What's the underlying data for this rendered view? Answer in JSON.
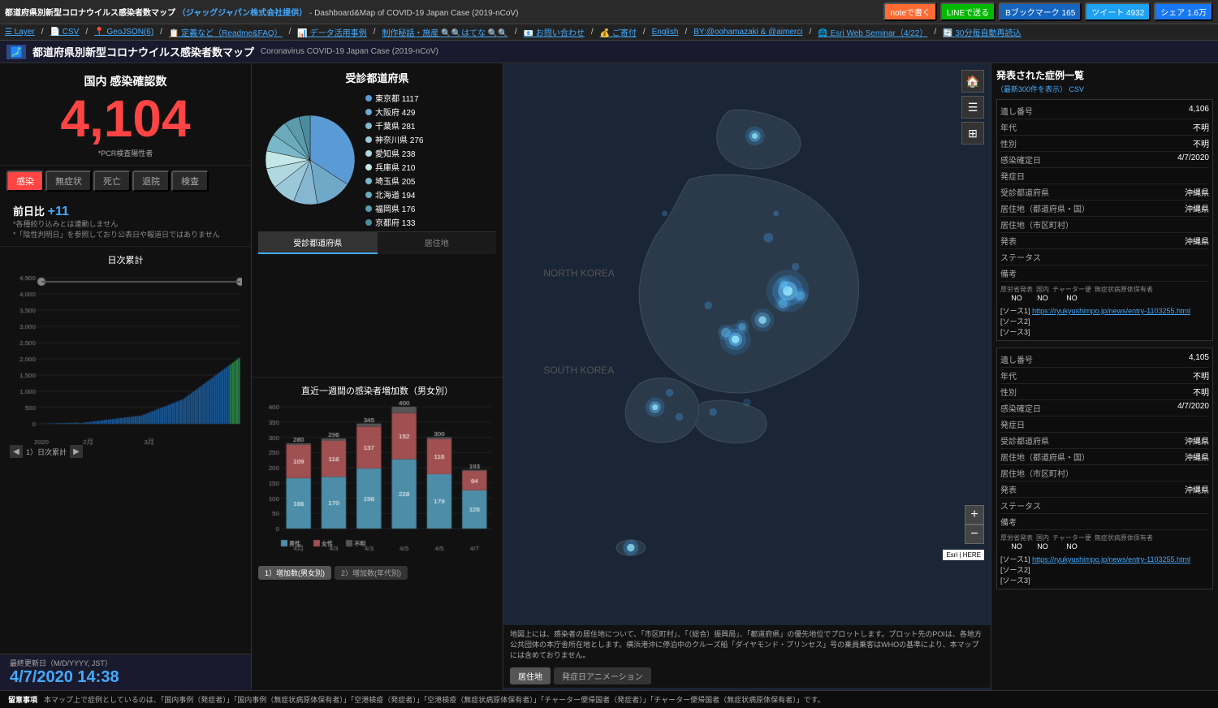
{
  "topbar": {
    "title": "都道府県別新型コロナウイルス感染者数マップ",
    "title_provider": "（ジャッグジャパン株式会社提供）",
    "title_en": "Dashboard&Map of COVID-19 Japan Case (2019-nCoV)",
    "links": [
      {
        "label": "Layer"
      },
      {
        "label": "CSV"
      },
      {
        "label": "GeoJSON(6)"
      },
      {
        "label": "定義など（Readme&FAQ）"
      },
      {
        "label": "データ活用事例"
      },
      {
        "label": "制作秘話・施産 @@はてな @@"
      },
      {
        "label": "お問い合わせ"
      },
      {
        "label": "ご寄付"
      },
      {
        "label": "English"
      },
      {
        "label": "BY:@oohamazaki & @aimerci"
      },
      {
        "label": "Esri Web Seminar（4/22）"
      },
      {
        "label": "30分毎自動再読込"
      }
    ],
    "btn_note": "noteで書く",
    "btn_line": "LINEで送る",
    "btn_bookmark": "Bブックマーク 165",
    "btn_tweet": "ツイート 4932",
    "btn_share": "シェア 1.6万"
  },
  "titlebar": {
    "main": "都道府県別新型コロナウイルス感染者数マップ",
    "sub": "Coronavirus COVID-19 Japan Case (2019-nCoV)"
  },
  "infection": {
    "label": "国内 感染確認数",
    "number": "4,104",
    "note": "*PCR検査陽性者",
    "tabs": [
      "感染",
      "無症状",
      "死亡",
      "退院",
      "検査"
    ]
  },
  "prev_day": {
    "title": "前日比 +11",
    "notes": [
      "*各種絞り込みとは連動しません",
      "*「陰性判明日」を参照しており公表日や報道日ではありません"
    ]
  },
  "daily_chart": {
    "title": "日次累計",
    "nav_label": "1）日次累計",
    "x_labels": [
      "2020",
      "2月",
      "3月"
    ],
    "y_labels": [
      "4,500",
      "4,000",
      "3,500",
      "3,000",
      "2,500",
      "2,000",
      "1,500",
      "1,000",
      "500",
      "0"
    ]
  },
  "bottom_left": {
    "date_label": "最終更新日（M/D/YYYY, JST）",
    "date": "4/7/2020 14:38"
  },
  "pie_chart": {
    "title": "受診都道府県",
    "items": [
      {
        "name": "東京都",
        "value": 1117,
        "color": "#5b9bd5"
      },
      {
        "name": "大阪府",
        "value": 429,
        "color": "#70a8c8"
      },
      {
        "name": "千葉県",
        "value": 281,
        "color": "#85b8d0"
      },
      {
        "name": "神奈川県",
        "value": 276,
        "color": "#9ac8d8"
      },
      {
        "name": "愛知県",
        "value": 238,
        "color": "#afd8e0"
      },
      {
        "name": "兵庫県",
        "value": 210,
        "color": "#c4e8e8"
      },
      {
        "name": "埼玉県",
        "value": 205,
        "color": "#79b8c8"
      },
      {
        "name": "北海道",
        "value": 194,
        "color": "#6aaabb"
      },
      {
        "name": "福岡県",
        "value": 176,
        "color": "#5b9bac"
      },
      {
        "name": "京都府",
        "value": 133,
        "color": "#4c8c9d"
      }
    ],
    "tabs": [
      "受診都道府県",
      "居住地"
    ]
  },
  "bar_chart": {
    "title": "直近一週間の感染者増加数（男女別）",
    "bars": [
      {
        "date": "4月",
        "male": 166,
        "female": 109,
        "unknown": 5
      },
      {
        "date": "4/3",
        "male": 170,
        "female": 118,
        "unknown": 8
      },
      {
        "date": "4/3",
        "male": 198,
        "female": 137,
        "unknown": 10
      },
      {
        "date": "4/5",
        "male": 228,
        "female": 152,
        "unknown": 20
      },
      {
        "date": "4/5",
        "male": 179,
        "female": 116,
        "unknown": 5
      },
      {
        "date": "4/7",
        "male": 126,
        "female": 64,
        "unknown": 3
      }
    ],
    "tabs": [
      "1）増加数(男女別)",
      "2）増加数(年代別)"
    ],
    "colors": {
      "male": "#4d8da8",
      "female": "#a05050",
      "unknown": "#555"
    }
  },
  "map": {
    "note": "地図上には、感染者の居住地について、「市区町村」、「（総合）振興局」、「都道府県」の優先地位でプロットします。プロット先のPOIは、各地方公共団体の本庁舎所在地とします。横浜港沖に停泊中のクルーズ船「ダイヤモンド・プリンセス」号の乗員乗客はWHOの基準により、本マップには含めておりません。",
    "tabs": [
      "居住地",
      "発症日アニメーション"
    ]
  },
  "cases_panel": {
    "title": "発表された症例一覧",
    "subtitle": "（最新300件を表示）",
    "csv_label": "CSV",
    "cases": [
      {
        "id": "4,106",
        "fields": [
          {
            "label": "遺し番号",
            "value": "4,106"
          },
          {
            "label": "年代",
            "value": "不明"
          },
          {
            "label": "性別",
            "value": "不明"
          },
          {
            "label": "感染確定日",
            "value": "4/7/2020"
          },
          {
            "label": "発症日",
            "value": ""
          },
          {
            "label": "受診都道府県",
            "value": "沖縄県"
          },
          {
            "label": "居住地（都道府県・国）",
            "value": "沖縄県"
          },
          {
            "label": "居住地（市区町村）",
            "value": ""
          },
          {
            "label": "発表",
            "value": "沖縄県"
          },
          {
            "label": "ステータス",
            "value": ""
          },
          {
            "label": "備考",
            "value": ""
          }
        ],
        "status": [
          {
            "label": "厚労省発表",
            "value": "NO"
          },
          {
            "label": "国内",
            "value": "NO"
          },
          {
            "label": "チャーター便",
            "value": "NO"
          },
          {
            "label": "無症状病原体保有者",
            "value": ""
          }
        ],
        "sources": [
          {
            "label": "ソース1",
            "url": "https://ryukyushimpo.jp/news/entry-1103255.html"
          },
          {
            "label": "ソース2",
            "url": ""
          },
          {
            "label": "ソース3",
            "url": ""
          }
        ]
      },
      {
        "id": "4,105",
        "fields": [
          {
            "label": "遺し番号",
            "value": "4,105"
          },
          {
            "label": "年代",
            "value": "不明"
          },
          {
            "label": "性別",
            "value": "不明"
          },
          {
            "label": "感染確定日",
            "value": "4/7/2020"
          },
          {
            "label": "発症日",
            "value": ""
          },
          {
            "label": "受診都道府県",
            "value": "沖縄県"
          },
          {
            "label": "居住地（都道府県・国）",
            "value": "沖縄県"
          },
          {
            "label": "居住地（市区町村）",
            "value": ""
          },
          {
            "label": "発表",
            "value": "沖縄県"
          },
          {
            "label": "ステータス",
            "value": ""
          },
          {
            "label": "備考",
            "value": ""
          }
        ],
        "status": [
          {
            "label": "厚労省発表",
            "value": "NO"
          },
          {
            "label": "国内",
            "value": "NO"
          },
          {
            "label": "チャーター便",
            "value": "NO"
          },
          {
            "label": "無症状病原体保有者",
            "value": ""
          }
        ],
        "sources": [
          {
            "label": "ソース1",
            "url": "https://ryukyushimpo.jp/news/entry-1103255.html"
          },
          {
            "label": "ソース2",
            "url": ""
          },
          {
            "label": "ソース3",
            "url": ""
          }
        ]
      }
    ]
  },
  "bottom_note": {
    "title": "留意事項",
    "text": "本マップ上で症例としているのは、「国内事例（発症者）」「国内事例（無症状病原体保有者）」「空港検疫（発症者）」「空港検疫（無症状病原体保有者）」「チャーター便帰国者（発症者）」「チャーター便帰国者（無症状病原体保有者）」です。"
  }
}
